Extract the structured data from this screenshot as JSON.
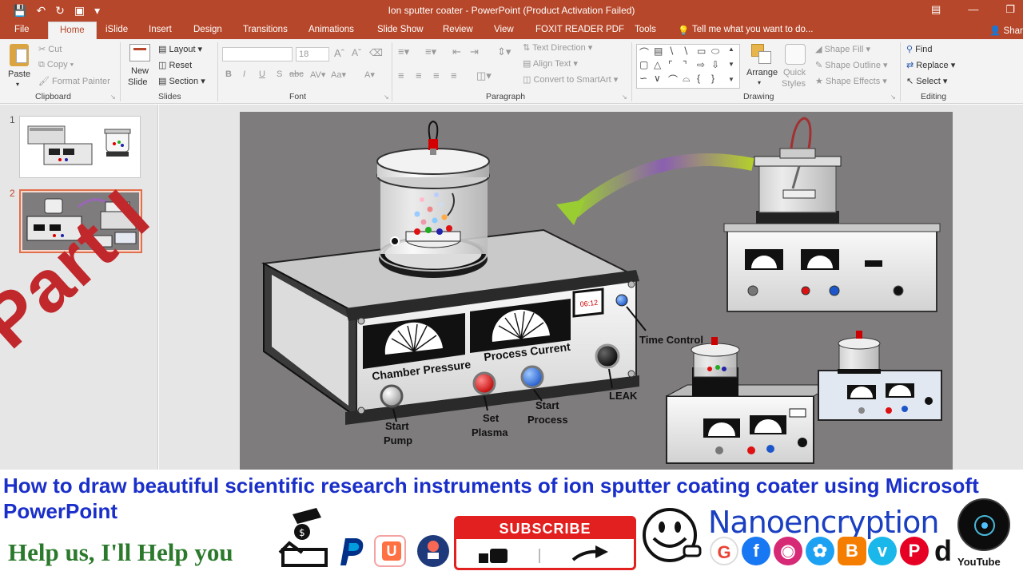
{
  "window": {
    "title": "Ion sputter coater - PowerPoint (Product Activation Failed)",
    "share": "Share"
  },
  "tabs": [
    "File",
    "Home",
    "iSlide",
    "Insert",
    "Design",
    "Transitions",
    "Animations",
    "Slide Show",
    "Review",
    "View",
    "FOXIT READER PDF",
    "Tools"
  ],
  "tell_me": "Tell me what you want to do...",
  "ribbon": {
    "clipboard": {
      "paste": "Paste",
      "cut": "Cut",
      "copy": "Copy",
      "format_painter": "Format Painter",
      "label": "Clipboard"
    },
    "slides": {
      "new_slide": "New",
      "new_slide2": "Slide",
      "layout": "Layout",
      "reset": "Reset",
      "section": "Section",
      "label": "Slides"
    },
    "font": {
      "size": "18",
      "label": "Font"
    },
    "paragraph": {
      "text_direction": "Text Direction",
      "align_text": "Align Text",
      "convert_smartart": "Convert to SmartArt",
      "label": "Paragraph"
    },
    "drawing": {
      "arrange": "Arrange",
      "quick_styles": "Quick",
      "quick_styles2": "Styles",
      "shape_fill": "Shape Fill",
      "shape_outline": "Shape Outline",
      "shape_effects": "Shape Effects",
      "label": "Drawing"
    },
    "editing": {
      "find": "Find",
      "replace": "Replace",
      "select": "Select",
      "label": "Editing"
    }
  },
  "slides_panel": [
    {
      "number": "1"
    },
    {
      "number": "2"
    }
  ],
  "slide": {
    "labels": {
      "chamber_pressure": "Chamber Pressure",
      "process_current": "Process Current",
      "time_control": "Time Control",
      "timer": "06:12",
      "leak": "LEAK",
      "start": "Start",
      "pump": "Pump",
      "set": "Set",
      "plasma": "Plasma",
      "start2": "Start",
      "process": "Process"
    }
  },
  "overlay": {
    "part": "Part I"
  },
  "banner": {
    "title": "How to draw beautiful scientific research instruments of ion sputter  coating coater using Microsoft PowerPoint",
    "help": "Help us, I'll Help you",
    "subscribe": "SUBSCRIBE",
    "brand": "Nanoencryption",
    "youtube": "YouTube"
  },
  "colors": {
    "accent": "#b7472a",
    "title_blue": "#1a2fc9",
    "help_green": "#2b7a2c",
    "part_red": "#c0282c"
  }
}
